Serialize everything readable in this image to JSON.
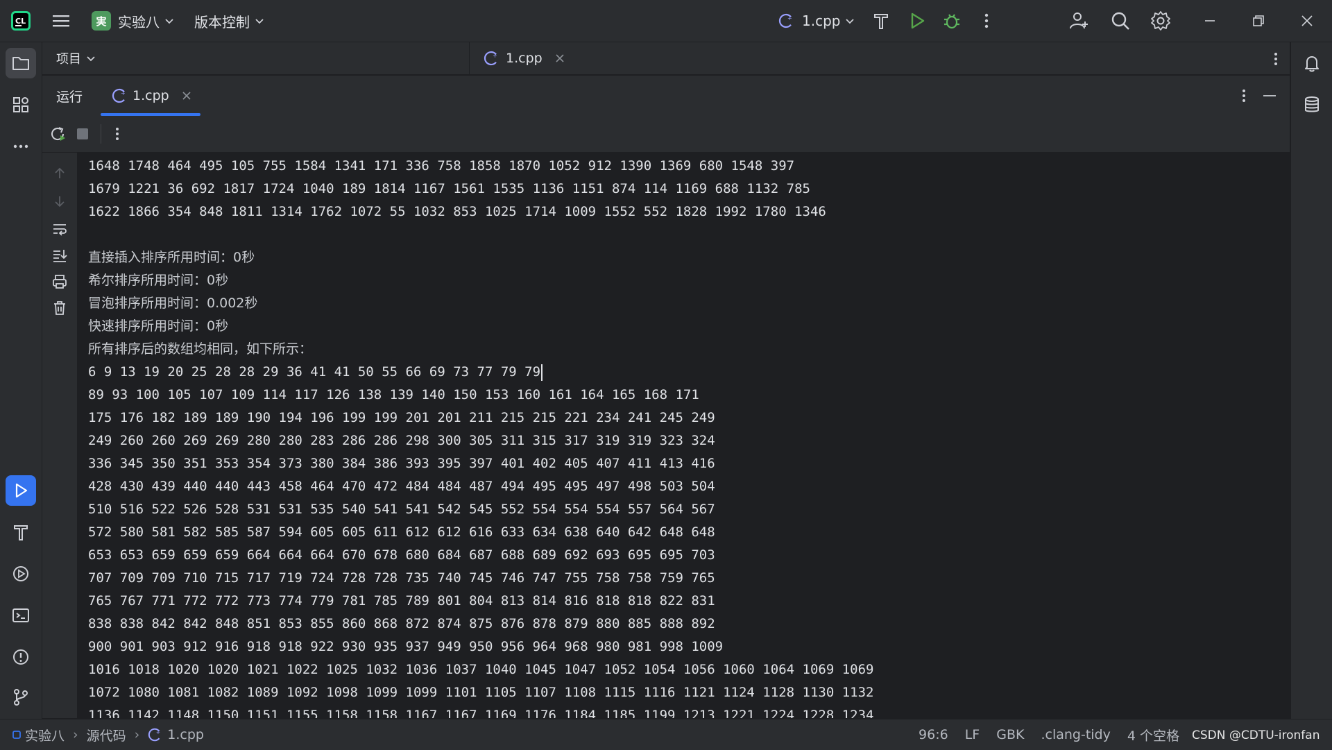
{
  "titlebar": {
    "project_badge": "実",
    "project_name": "实验八",
    "vcs_label": "版本控制",
    "run_config": "1.cpp"
  },
  "project_panel": {
    "title": "项目"
  },
  "editor": {
    "tab_label": "1.cpp"
  },
  "run_window": {
    "title": "运行",
    "tab_label": "1.cpp",
    "lines": [
      "1648 1748 464 495 105 755 1584 1341 171 336 758 1858 1870 1052 912 1390 1369 680 1548 397",
      "1679 1221 36 692 1817 1724 1040 189 1814 1167 1561 1535 1136 1151 874 114 1169 688 1132 785",
      "1622 1866 354 848 1811 1314 1762 1072 55 1032 853 1025 1714 1009 1552 552 1828 1992 1780 1346",
      "",
      "直接插入排序所用时间：0秒",
      "希尔排序所用时间：0秒",
      "冒泡排序所用时间：0.002秒",
      "快速排序所用时间：0秒",
      "所有排序后的数组均相同，如下所示：",
      "6 9 13 19 20 25 28 28 29 36 41 41 50 55 66 69 73 77 79 79",
      "89 93 100 105 107 109 114 117 126 138 139 140 150 153 160 161 164 165 168 171",
      "175 176 182 189 189 190 194 196 199 199 201 201 211 215 215 221 234 241 245 249",
      "249 260 260 269 269 280 280 283 286 286 298 300 305 311 315 317 319 319 323 324",
      "336 345 350 351 353 354 373 380 384 386 393 395 397 401 402 405 407 411 413 416",
      "428 430 439 440 440 443 458 464 470 472 484 484 487 494 495 495 497 498 503 504",
      "510 516 522 526 528 531 531 535 540 541 541 542 545 552 554 554 554 557 564 567",
      "572 580 581 582 585 587 594 605 605 611 612 612 616 633 634 638 640 642 648 648",
      "653 653 659 659 659 664 664 664 670 678 680 684 687 688 689 692 693 695 695 703",
      "707 709 709 710 715 717 719 724 728 728 735 740 745 746 747 755 758 758 759 765",
      "765 767 771 772 772 773 774 779 781 785 789 801 804 813 814 816 818 818 822 831",
      "838 838 842 842 848 851 853 855 860 868 872 874 875 876 878 879 880 885 888 892",
      "900 901 903 912 916 918 918 922 930 935 937 949 950 956 964 968 980 981 998 1009",
      "1016 1018 1020 1020 1021 1022 1025 1032 1036 1037 1040 1045 1047 1052 1054 1056 1060 1064 1069 1069",
      "1072 1080 1081 1082 1089 1092 1098 1099 1099 1101 1105 1107 1108 1115 1116 1121 1124 1128 1130 1132",
      "1136 1142 1148 1150 1151 1155 1158 1158 1167 1167 1169 1176 1184 1185 1199 1213 1221 1224 1228 1234"
    ]
  },
  "statusbar": {
    "breadcrumb": [
      "实验八",
      "源代码",
      "1.cpp"
    ],
    "position": "96:6",
    "line_ending": "LF",
    "encoding": "GBK",
    "linter": ".clang-tidy",
    "indent": "4 个空格",
    "watermark": "CSDN @CDTU-ironfan"
  },
  "colors": {
    "accent": "#3574f0",
    "background": "#1e1f22",
    "panel": "#2b2d30",
    "run_green": "#57a64a",
    "debug_green": "#5fb85f"
  },
  "icons": [
    "clion-logo-icon",
    "hamburger-menu-icon",
    "chevron-down-icon",
    "cpp-file-icon",
    "build-hammer-icon",
    "run-play-icon",
    "debug-bug-icon",
    "more-vertical-icon",
    "add-user-icon",
    "search-icon",
    "settings-gear-icon",
    "minimize-icon",
    "restore-icon",
    "close-icon",
    "folder-icon",
    "structure-icon",
    "more-horizontal-icon",
    "run-tool-icon",
    "build-tool-icon",
    "services-icon",
    "terminal-icon",
    "problems-icon",
    "git-icon",
    "notifications-bell-icon",
    "database-icon",
    "rerun-icon",
    "stop-icon",
    "scroll-up-icon",
    "scroll-down-icon",
    "soft-wrap-icon",
    "scroll-to-end-icon",
    "print-icon",
    "trash-icon"
  ]
}
